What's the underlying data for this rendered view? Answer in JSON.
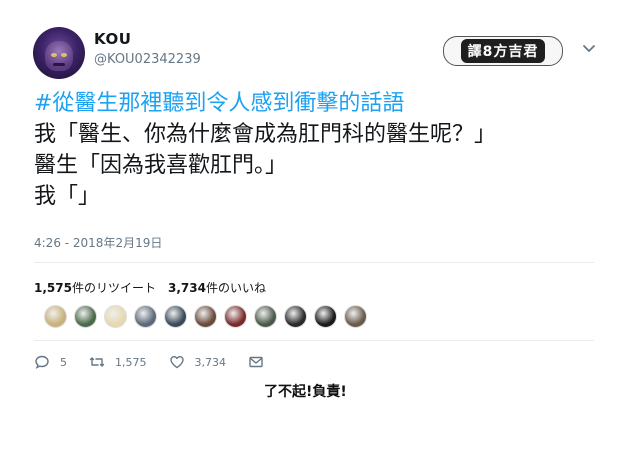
{
  "user": {
    "name": "KOU",
    "handle": "@KOU02342239",
    "avatar_icon": "villain-avatar"
  },
  "badge": {
    "text": "譯8方吉君"
  },
  "tweet": {
    "hashtag": "#從醫生那裡聽到令人感到衝擊的話語",
    "lines": [
      "我「醫生、你為什麼會成為肛門科的醫生呢？」",
      "醫生「因為我喜歡肛門。」",
      "我「」"
    ],
    "timestamp": "4:26 - 2018年2月19日"
  },
  "stats": {
    "retweets_count": "1,575",
    "retweets_label": "件のリツイート",
    "likes_count": "3,734",
    "likes_label": "件のいいね"
  },
  "liker_avatars": [
    "#c9b27a",
    "#4a6a4a",
    "#e8d8b0",
    "#5a6a7a",
    "#3a4a5a",
    "#6a4a3a",
    "#7a2a2a",
    "#4a5a4a",
    "#2a2a2a",
    "#1a1a1a",
    "#6a5a4a"
  ],
  "actions": {
    "reply_count": "5",
    "retweet_count": "1,575",
    "like_count": "3,734"
  },
  "caption": "了不起!負責!"
}
